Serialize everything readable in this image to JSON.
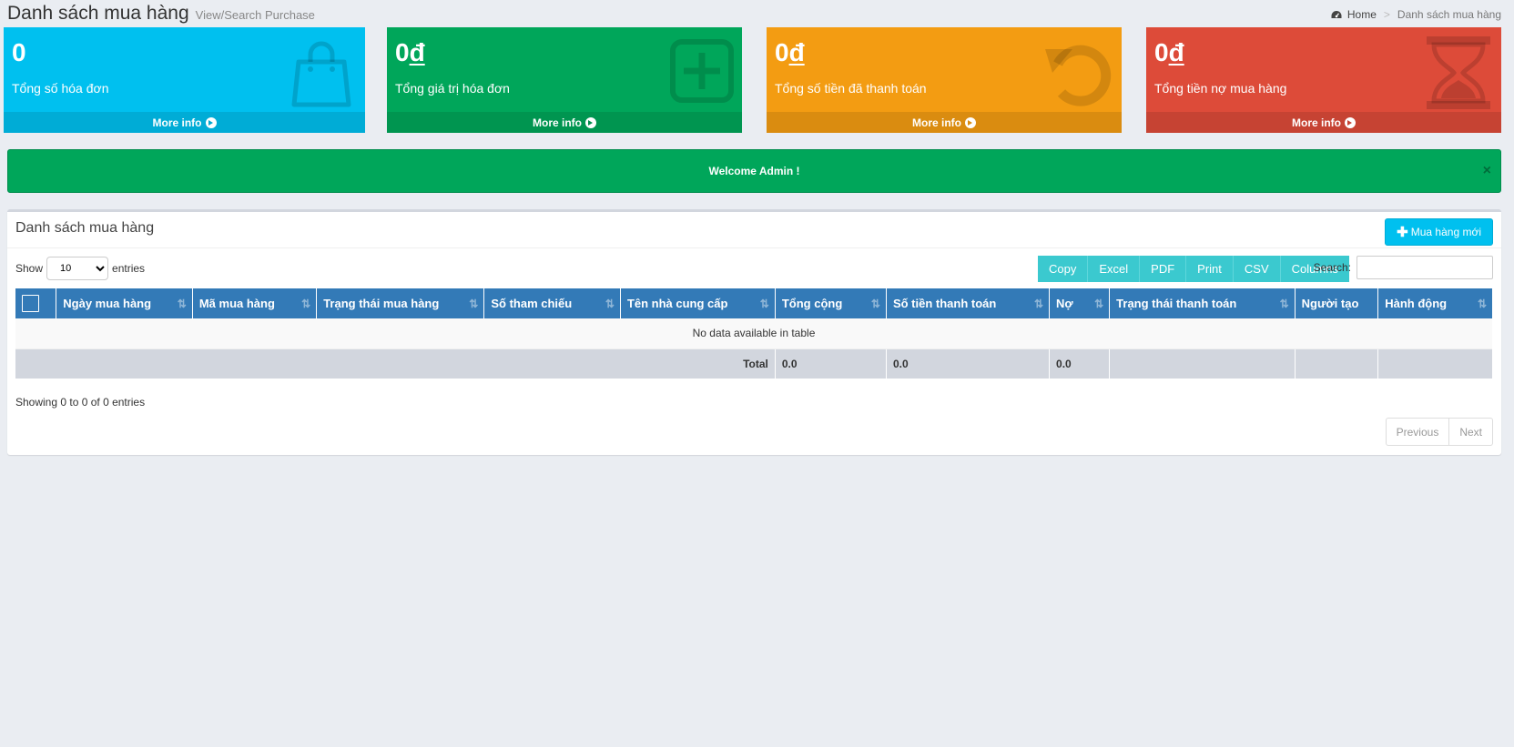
{
  "header": {
    "title": "Danh sách mua hàng",
    "subtitle": "View/Search Purchase",
    "breadcrumb": {
      "home": "Home",
      "current": "Danh sách mua hàng"
    }
  },
  "stats": [
    {
      "value": "0",
      "currency": "",
      "label": "Tổng số hóa đơn",
      "more": "More info",
      "icon": "shopping-bag-icon",
      "color": "#00c0ef"
    },
    {
      "value": "0",
      "currency": "đ",
      "label": "Tổng giá trị hóa đơn",
      "more": "More info",
      "icon": "plus-square-icon",
      "color": "#00a65a"
    },
    {
      "value": "0",
      "currency": "đ",
      "label": "Tổng số tiền đã thanh toán",
      "more": "More info",
      "icon": "undo-icon",
      "color": "#f39c12"
    },
    {
      "value": "0",
      "currency": "đ",
      "label": "Tổng tiền nợ mua hàng",
      "more": "More info",
      "icon": "hourglass-icon",
      "color": "#dd4b39"
    }
  ],
  "alert": {
    "message": "Welcome Admin !",
    "close": "×"
  },
  "panel": {
    "title": "Danh sách mua hàng",
    "new_button": "Mua hàng mới",
    "show_label": "Show",
    "entries_value": "10",
    "entries_label": "entries",
    "export_buttons": [
      "Copy",
      "Excel",
      "PDF",
      "Print",
      "CSV",
      "Columns"
    ],
    "search_label": "Search:",
    "search_value": ""
  },
  "table": {
    "columns": [
      "Ngày mua hàng",
      "Mã mua hàng",
      "Trạng thái mua hàng",
      "Số tham chiếu",
      "Tên nhà cung cấp",
      "Tổng cộng",
      "Số tiền thanh toán",
      "Nợ",
      "Trạng thái thanh toán",
      "Người tạo",
      "Hành động"
    ],
    "empty_message": "No data available in table",
    "footer": {
      "label": "Total",
      "total": "0.0",
      "paid": "0.0",
      "debt": "0.0"
    }
  },
  "info": "Showing 0 to 0 of 0 entries",
  "pagination": {
    "previous": "Previous",
    "next": "Next"
  }
}
